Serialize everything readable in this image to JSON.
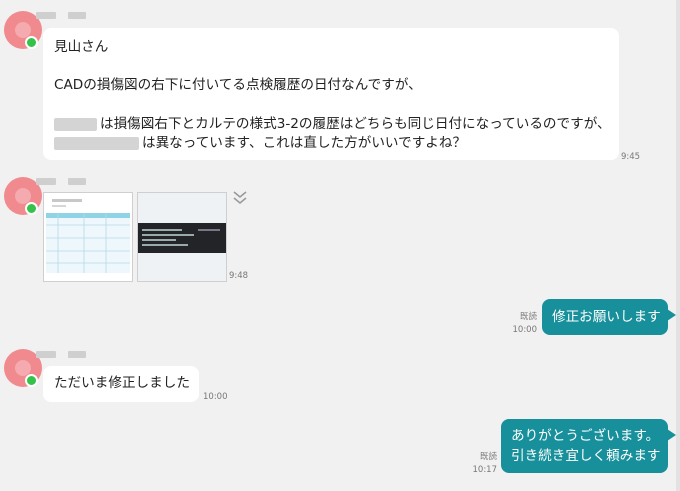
{
  "chat": {
    "msg1": {
      "line1": "見山さん",
      "line2": "CADの損傷図の右下に付いてる点検履歴の日付なんですが、",
      "line3": "は損傷図右下とカルテの様式3-2の履歴はどちらも同じ日付になっているのですが、",
      "line4": "は異なっています、これは直した方がいいですよね？",
      "time": "9:45"
    },
    "msg2": {
      "time": "9:48"
    },
    "msg3": {
      "text": "修正お願いします",
      "read": "既読",
      "time": "10:00"
    },
    "msg4": {
      "text": "ただいま修正しました",
      "time": "10:00"
    },
    "msg5": {
      "line1": "ありがとうございます。",
      "line2": "引き続き宜しく頼みます",
      "read": "既読",
      "time": "10:17"
    }
  },
  "colors": {
    "outgoing": "#17909b",
    "incoming": "#ffffff",
    "avatar": "#f08a8e",
    "online": "#35c24a"
  },
  "icons": {
    "expand": "chevron-double-down-icon"
  }
}
